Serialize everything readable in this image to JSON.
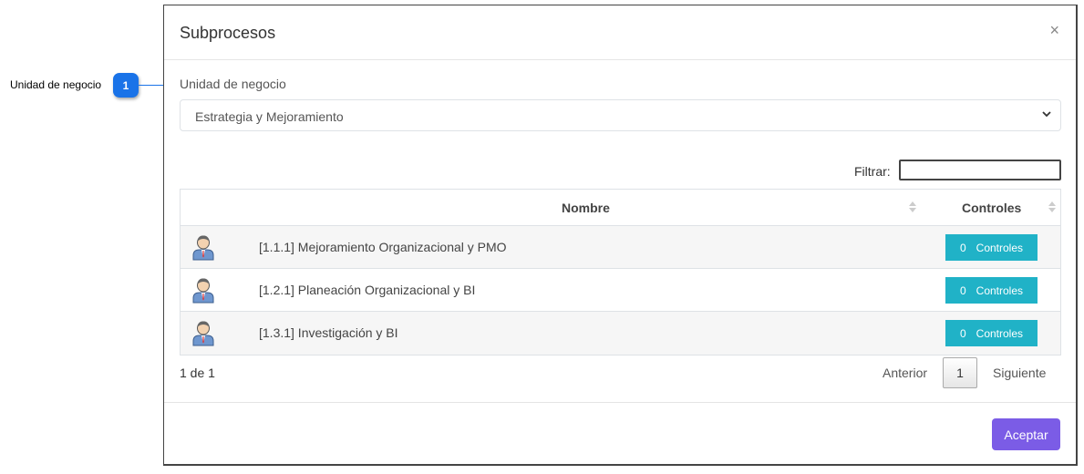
{
  "annotation": {
    "label": "Unidad de negocio",
    "badge": "1"
  },
  "modal": {
    "title": "Subprocesos",
    "close": "×",
    "field_label": "Unidad de negocio",
    "select_value": "Estrategia y Mejoramiento",
    "filter_label": "Filtrar:",
    "filter_value": "",
    "table": {
      "columns": [
        "Nombre",
        "Controles"
      ],
      "rows": [
        {
          "icon": "user-icon",
          "name": "[1.1.1] Mejoramiento Organizacional y PMO",
          "count": "0",
          "button": "Controles"
        },
        {
          "icon": "user-icon",
          "name": "[1.2.1] Planeación Organizacional y BI",
          "count": "0",
          "button": "Controles"
        },
        {
          "icon": "user-icon",
          "name": "[1.3.1] Investigación y BI",
          "count": "0",
          "button": "Controles"
        }
      ]
    },
    "pagination": {
      "info": "1 de 1",
      "prev": "Anterior",
      "page": "1",
      "next": "Siguiente"
    },
    "accept": "Aceptar"
  },
  "colors": {
    "accent": "#1a73e8",
    "controls_button": "#20b2c7",
    "accept_button": "#7b5ce6"
  }
}
